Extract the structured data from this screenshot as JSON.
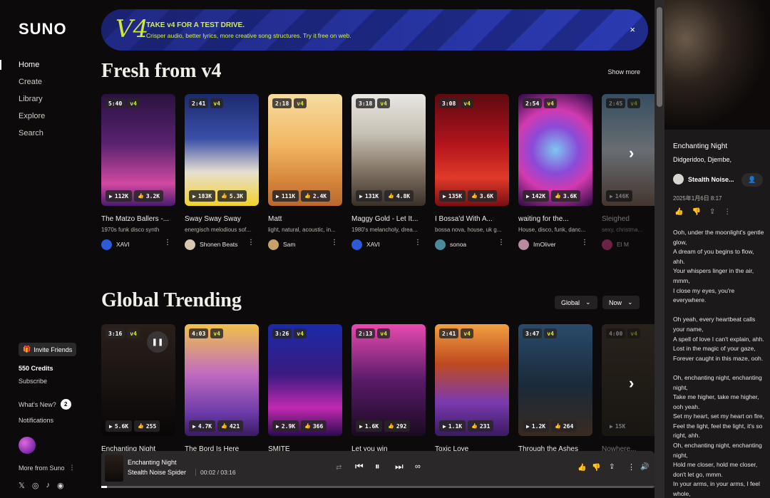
{
  "sidebar": {
    "logo": "SUNO",
    "nav": [
      "Home",
      "Create",
      "Library",
      "Explore",
      "Search"
    ],
    "invite": "Invite Friends",
    "credits": "550 Credits",
    "subscribe": "Subscribe",
    "whats_new": "What's New?",
    "whats_new_count": "2",
    "notifications": "Notifications",
    "more_from_suno": "More from Suno",
    "social_icons": [
      "x-icon",
      "instagram-icon",
      "tiktok-icon",
      "discord-icon"
    ]
  },
  "banner": {
    "logo": "V4",
    "title": "TAKE v4 FOR A TEST DRIVE.",
    "subtitle": "Crisper audio, better lyrics, more creative song structures. Try it free on web.",
    "close": "×"
  },
  "fresh": {
    "title": "Fresh from v4",
    "show_more": "Show more",
    "cards": [
      {
        "duration": "5:40",
        "version": "v4",
        "plays": "112K",
        "likes": "3.2K",
        "title": "The Matzo Ballers -...",
        "tags": "1970s funk disco synth",
        "user": "XAVI",
        "bg": "linear-gradient(180deg,#2a1240 0%,#5a2270 45%,#d04aa0 80%,#4a1a70 100%)",
        "av": "#2b5bd9"
      },
      {
        "duration": "2:41",
        "version": "v4",
        "plays": "183K",
        "likes": "5.3K",
        "title": "Sway Sway Sway",
        "tags": "energisch melodious sof...",
        "user": "Shonen Beats",
        "bg": "linear-gradient(180deg,#1c2a6e 0%,#3a4fa8 40%,#e7e0d0 70%,#f2d22a 100%)",
        "av": "#d9c6b0"
      },
      {
        "duration": "2:18",
        "version": "v4",
        "plays": "111K",
        "likes": "2.4K",
        "title": "Matt",
        "tags": "light, natural, acoustic, in...",
        "user": "Sam",
        "bg": "linear-gradient(180deg,#f6dca0 0%,#f2b764 45%,#d98a3e 75%,#b8682c 100%)",
        "av": "#c9a06a"
      },
      {
        "duration": "3:18",
        "version": "v4",
        "plays": "131K",
        "likes": "4.8K",
        "title": "Maggy Gold - Let It...",
        "tags": "1980's melancholy, drea...",
        "user": "XAVI",
        "bg": "linear-gradient(180deg,#e9e7e2 0%,#c7c1b6 35%,#8a7c6d 65%,#3a3028 100%)",
        "av": "#2b5bd9"
      },
      {
        "duration": "3:08",
        "version": "v4",
        "plays": "135K",
        "likes": "3.6K",
        "title": "I Bossa'd With A...",
        "tags": "bossa nova, house, uk g...",
        "user": "sonoa",
        "bg": "linear-gradient(180deg,#5e0a10 0%,#b3141c 45%,#e03a2a 75%,#7a0e12 100%)",
        "av": "#4a8a9a"
      },
      {
        "duration": "2:54",
        "version": "v4",
        "plays": "142K",
        "likes": "3.6K",
        "title": "waiting for the...",
        "tags": "House, disco, funk, danc...",
        "user": "ImOliver",
        "bg": "radial-gradient(circle at 50% 50%,#7ec6f0 0%,#8a4ad8 35%,#d23ab0 60%,#2a0a40 100%)",
        "av": "#b88aa0"
      },
      {
        "duration": "2:45",
        "version": "v4",
        "plays": "146K",
        "likes": "",
        "title": "Sleighed",
        "tags": "sexy, christma...",
        "user": "El M",
        "bg": "linear-gradient(180deg,#6aa0c8 0%,#d6e6f0 50%,#8a6a5a 100%)",
        "av": "#e0408a"
      }
    ]
  },
  "trending": {
    "title": "Global Trending",
    "filter_region": "Global",
    "filter_time": "Now",
    "cards": [
      {
        "duration": "3:16",
        "version": "v4",
        "plays": "5.6K",
        "likes": "255",
        "title": "Enchanting Night",
        "bg": "linear-gradient(180deg,#2a1f1a 0%,#1a1412 50%,#080606 100%)"
      },
      {
        "duration": "4:03",
        "version": "v4",
        "plays": "4.7K",
        "likes": "421",
        "title": "The Bord Is Here",
        "bg": "linear-gradient(180deg,#f0c24a 0%,#c06ac0 45%,#6a3aa8 80%,#3a1a60 100%)"
      },
      {
        "duration": "3:26",
        "version": "v4",
        "plays": "2.9K",
        "likes": "366",
        "title": "SMITE",
        "bg": "linear-gradient(180deg,#1a2aa8 0%,#3a1a80 45%,#c02ab0 75%,#2a0a50 100%)"
      },
      {
        "duration": "2:13",
        "version": "v4",
        "plays": "1.6K",
        "likes": "292",
        "title": "Let you win",
        "bg": "linear-gradient(180deg,#e84ab0 0%,#5a1a6a 50%,#1a0a20 100%)"
      },
      {
        "duration": "2:41",
        "version": "v4",
        "plays": "1.1K",
        "likes": "231",
        "title": "Toxic Love",
        "bg": "linear-gradient(180deg,#f0a040 0%,#c04a20 35%,#7a3ab0 70%,#3a1a60 100%)"
      },
      {
        "duration": "3:47",
        "version": "v4",
        "plays": "1.2K",
        "likes": "264",
        "title": "Through the Ashes",
        "bg": "linear-gradient(180deg,#2a4a6a 0%,#1a2a3a 55%,#3a2a20 100%)"
      },
      {
        "duration": "4:00",
        "version": "v4",
        "plays": "15K",
        "likes": "",
        "title": "Nowhere...",
        "bg": "linear-gradient(180deg,#4a4030 0%,#2a2418 100%)"
      }
    ]
  },
  "player": {
    "title": "Enchanting Night",
    "artist": "Stealth Noise Spider",
    "time": "00:02 / 03:16",
    "progress_fraction": 0.01
  },
  "panel": {
    "title": "Enchanting Night",
    "tags": "Didgeridoo,  Djembe,",
    "artist": "Stealth Noise...",
    "date": "2025年1月6日 8:17",
    "lyrics": [
      "Ooh, under the moonlight's gentle glow,\nA dream of you begins to flow, ahh.\nYour whispers linger in the air, mmm,\nI close my eyes, you're everywhere.",
      "Oh yeah, every heartbeat calls your name,\nA spell of love I can't explain, ahh.\nLost in the magic of your gaze,\nForever caught in this maze, ooh.",
      "Oh, enchanting night, enchanting night,\nTake me higher, take me higher, ooh yeah.\nSet my heart, set my heart on fire,\nFeel the light, feel the light, it's so right, ahh.\nOh, enchanting night, enchanting night,\nHold me closer, hold me closer, don't let go, mmm.\nIn your arms, in your arms, I feel whole,"
    ]
  }
}
